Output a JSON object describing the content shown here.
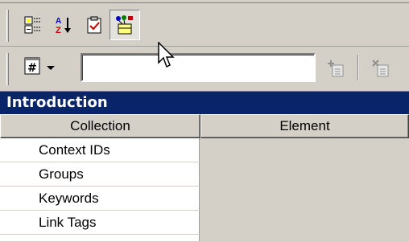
{
  "toolbar_top": {
    "buttons": [
      {
        "icon": "categorized-view-icon",
        "pressed": false
      },
      {
        "icon": "sort-az-icon",
        "pressed": false
      },
      {
        "icon": "checklist-icon",
        "pressed": false
      },
      {
        "icon": "collection-properties-icon",
        "pressed": true
      }
    ]
  },
  "toolbar_bottom": {
    "combo_icon": "hash-box-icon",
    "input_value": "",
    "add_button_icon": "add-item-icon",
    "delete_button_icon": "delete-item-icon"
  },
  "panel": {
    "title": "Introduction"
  },
  "grid": {
    "columns": [
      "Collection",
      "Element"
    ],
    "rows": [
      "Context IDs",
      "Groups",
      "Keywords",
      "Link Tags"
    ]
  },
  "colors": {
    "title_bar": "#0a246a",
    "face": "#d4d0c8",
    "window": "#ffffff"
  }
}
